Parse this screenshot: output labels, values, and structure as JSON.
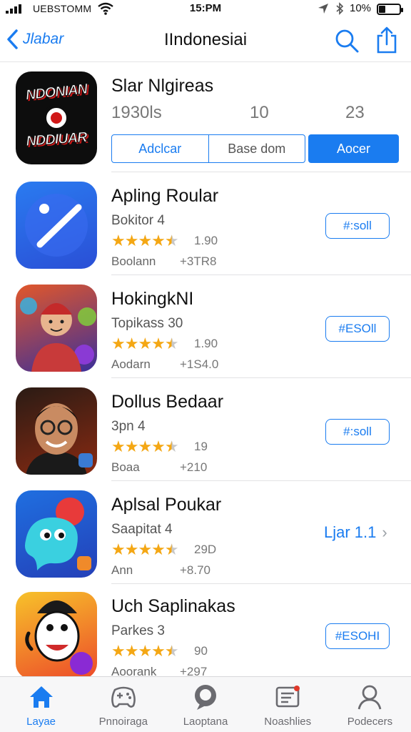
{
  "status_bar": {
    "carrier": "UEBSTOMM",
    "time": "15:PM",
    "battery_percent": "10%",
    "battery_level": 0.3
  },
  "nav": {
    "back_label": "Jlabar",
    "title": "IIndonesiai",
    "icons": [
      "chevron-left-icon",
      "search-icon",
      "share-icon"
    ]
  },
  "featured": {
    "name": "Slar Nlgireas",
    "icon_text_top": "NDONIAN",
    "icon_text_bottom": "NDDIUAR",
    "stats": [
      "1930ls",
      "10",
      "23"
    ],
    "segments": [
      "Adclcar",
      "Base dom"
    ],
    "action_label": "Aocer"
  },
  "apps": [
    {
      "name": "Apling Roular",
      "subtitle": "Bokitor 4",
      "rating": 4.5,
      "rating_text": "1.90",
      "meta1": "Boolann",
      "meta2": "+3TR8",
      "button": "#:soll",
      "icon": "pencil-icon"
    },
    {
      "name": "HokingkNI",
      "subtitle": "Topikass 30",
      "rating": 4.5,
      "rating_text": "1.90",
      "meta1": "Aodarn",
      "meta2": "+1S4.0",
      "button": "#ESOll",
      "icon": "avatar-icon"
    },
    {
      "name": "Dollus Bedaar",
      "subtitle": "3pn 4",
      "rating": 4.5,
      "rating_text": "19",
      "meta1": "Boaa",
      "meta2": "+210",
      "button": "#:soll",
      "icon": "portrait-icon"
    },
    {
      "name": "Aplsal Poukar",
      "subtitle": "Saapitat 4",
      "rating": 4.5,
      "rating_text": "29D",
      "meta1": "Ann",
      "meta2": "+8.70",
      "link": "Ljar 1.1",
      "icon": "creature-icon"
    },
    {
      "name": "Uch Saplinakas",
      "subtitle": "Parkes 3",
      "rating": 4.5,
      "rating_text": "90",
      "meta1": "Aoorank",
      "meta2": "+297",
      "button": "#ESOHI",
      "icon": "character-icon"
    }
  ],
  "tabbar": {
    "tabs": [
      {
        "label": "Layae",
        "icon": "home-icon",
        "active": true
      },
      {
        "label": "Pnnoiraga",
        "icon": "gamepad-icon",
        "active": false
      },
      {
        "label": "Laoptana",
        "icon": "chat-icon",
        "active": false
      },
      {
        "label": "Noashlies",
        "icon": "news-icon",
        "active": false
      },
      {
        "label": "Podecers",
        "icon": "profile-icon",
        "active": false
      }
    ]
  }
}
